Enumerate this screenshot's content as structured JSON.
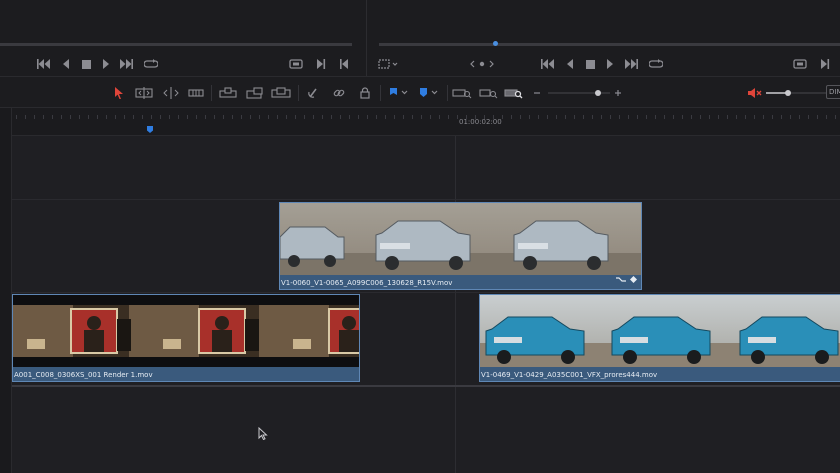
{
  "colors": {
    "accent": "#2f7de1",
    "clip_fill": "#3a5a7d",
    "clip_border": "#5f87b5",
    "active_tool": "#e0453a",
    "mute": "#e0453a"
  },
  "viewer_source": {
    "controls": [
      "jump-start-icon",
      "step-back-icon",
      "stop-icon",
      "play-icon",
      "jump-end-icon",
      "loop-icon"
    ],
    "right_controls": [
      "match-frame-icon",
      "mark-in-icon",
      "mark-out-icon"
    ]
  },
  "viewer_timeline": {
    "left_controls": [
      "view-options-icon",
      "nav-prev-icon",
      "nav-next-icon"
    ],
    "controls": [
      "jump-start-icon",
      "step-back-icon",
      "stop-icon",
      "play-icon",
      "jump-end-icon",
      "loop-icon"
    ],
    "right_controls": [
      "match-frame-icon",
      "mark-in-icon"
    ]
  },
  "toolbar": {
    "dim_label": "DIM"
  },
  "timeline": {
    "timecode": "01:00:02:00",
    "clips": [
      {
        "name": "V1-0060_V1-0065_A099C006_130628_R15V.mov",
        "track": "V2"
      },
      {
        "name": "A001_C008_0306XS_001 Render 1.mov",
        "track": "V1"
      },
      {
        "name": "V1-0469_V1-0429_A035C001_VFX_prores444.mov",
        "track": "V1"
      }
    ]
  }
}
